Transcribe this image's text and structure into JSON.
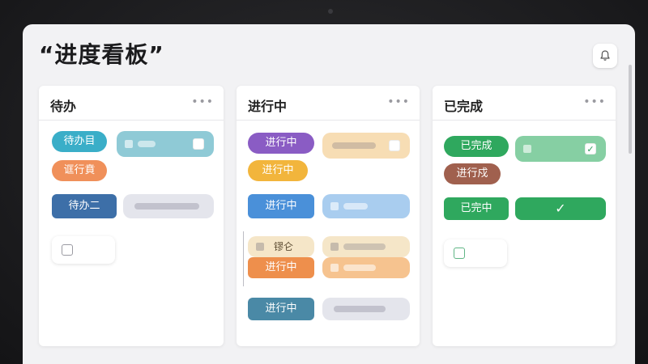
{
  "board": {
    "title": "“进度看板”"
  },
  "columns": [
    {
      "title": "待办",
      "more": "•••",
      "tags": [
        "待办目",
        "诓行賁",
        "待办二"
      ]
    },
    {
      "title": "进行中",
      "more": "•••",
      "tags": [
        "进行中",
        "进行中",
        "进行中",
        "镠仑",
        "进行中",
        "进行中"
      ]
    },
    {
      "title": "已完成",
      "more": "•••",
      "tags": [
        "已完成",
        "进行戍",
        "已完中"
      ],
      "check": "✓"
    }
  ],
  "colors": {
    "teal": "#3aaec8",
    "orange": "#f0905a",
    "navy": "#3d6fa8",
    "purple": "#8a5cc4",
    "amber": "#f2b53c",
    "blue": "#4a90d9",
    "steel": "#4a89a6",
    "green": "#2fa85e",
    "brown": "#a0604e"
  },
  "icons": [
    "bell-icon",
    "more-icon",
    "checkbox-icon",
    "checkmark-icon"
  ]
}
